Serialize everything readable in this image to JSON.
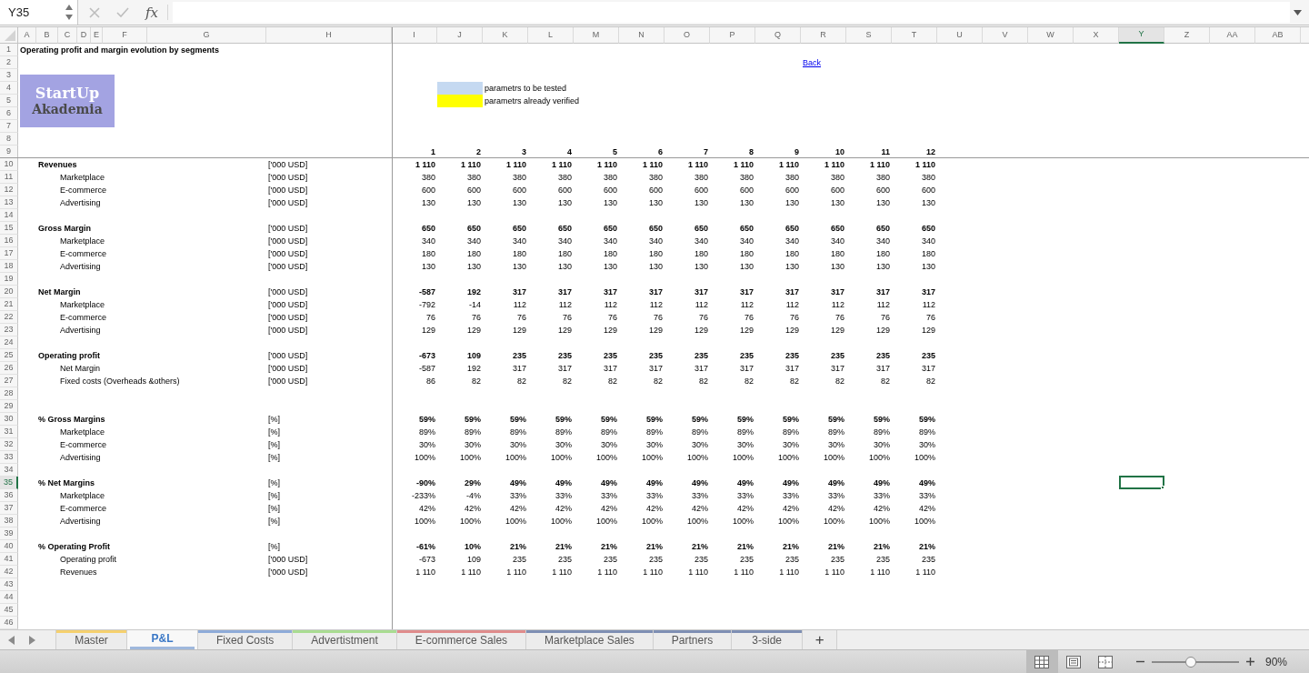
{
  "formula_bar": {
    "name_box": "Y35",
    "function_label": "fx"
  },
  "columns": [
    {
      "label": "A",
      "selected": false
    },
    {
      "label": "B",
      "selected": false
    },
    {
      "label": "C",
      "selected": false
    },
    {
      "label": "D",
      "selected": false
    },
    {
      "label": "E",
      "selected": false
    },
    {
      "label": "F",
      "selected": false
    },
    {
      "label": "G",
      "selected": false
    },
    {
      "label": "H",
      "selected": false
    },
    {
      "label": "I",
      "selected": false
    },
    {
      "label": "J",
      "selected": false
    },
    {
      "label": "K",
      "selected": false
    },
    {
      "label": "L",
      "selected": false
    },
    {
      "label": "M",
      "selected": false
    },
    {
      "label": "N",
      "selected": false
    },
    {
      "label": "O",
      "selected": false
    },
    {
      "label": "P",
      "selected": false
    },
    {
      "label": "Q",
      "selected": false
    },
    {
      "label": "R",
      "selected": false
    },
    {
      "label": "S",
      "selected": false
    },
    {
      "label": "T",
      "selected": false
    },
    {
      "label": "U",
      "selected": false
    },
    {
      "label": "V",
      "selected": false
    },
    {
      "label": "W",
      "selected": false
    },
    {
      "label": "X",
      "selected": false
    },
    {
      "label": "Y",
      "selected": true
    },
    {
      "label": "Z",
      "selected": false
    },
    {
      "label": "AA",
      "selected": false
    },
    {
      "label": "AB",
      "selected": false
    }
  ],
  "rows": [
    {
      "label": "1",
      "selected": false
    },
    {
      "label": "2",
      "selected": false
    },
    {
      "label": "3",
      "selected": false
    },
    {
      "label": "4",
      "selected": false
    },
    {
      "label": "5",
      "selected": false
    },
    {
      "label": "6",
      "selected": false
    },
    {
      "label": "7",
      "selected": false
    },
    {
      "label": "8",
      "selected": false
    },
    {
      "label": "9",
      "selected": false
    },
    {
      "label": "10",
      "selected": false
    },
    {
      "label": "11",
      "selected": false
    },
    {
      "label": "12",
      "selected": false
    },
    {
      "label": "13",
      "selected": false
    },
    {
      "label": "14",
      "selected": false
    },
    {
      "label": "15",
      "selected": false
    },
    {
      "label": "16",
      "selected": false
    },
    {
      "label": "17",
      "selected": false
    },
    {
      "label": "18",
      "selected": false
    },
    {
      "label": "19",
      "selected": false
    },
    {
      "label": "20",
      "selected": false
    },
    {
      "label": "21",
      "selected": false
    },
    {
      "label": "22",
      "selected": false
    },
    {
      "label": "23",
      "selected": false
    },
    {
      "label": "24",
      "selected": false
    },
    {
      "label": "25",
      "selected": false
    },
    {
      "label": "26",
      "selected": false
    },
    {
      "label": "27",
      "selected": false
    },
    {
      "label": "28",
      "selected": false
    },
    {
      "label": "29",
      "selected": false
    },
    {
      "label": "30",
      "selected": false
    },
    {
      "label": "31",
      "selected": false
    },
    {
      "label": "32",
      "selected": false
    },
    {
      "label": "33",
      "selected": false
    },
    {
      "label": "34",
      "selected": false
    },
    {
      "label": "35",
      "selected": true
    },
    {
      "label": "36",
      "selected": false
    },
    {
      "label": "37",
      "selected": false
    },
    {
      "label": "38",
      "selected": false
    },
    {
      "label": "39",
      "selected": false
    },
    {
      "label": "40",
      "selected": false
    },
    {
      "label": "41",
      "selected": false
    },
    {
      "label": "42",
      "selected": false
    },
    {
      "label": "43",
      "selected": false
    },
    {
      "label": "44",
      "selected": false
    },
    {
      "label": "45",
      "selected": false
    },
    {
      "label": "46",
      "selected": false
    }
  ],
  "sheet": {
    "title": "Operating profit and margin evolution by segments",
    "logo": {
      "top_word": "StartUp",
      "bottom_word": "Akademia"
    },
    "back_link": "Back",
    "legend": [
      {
        "label": "parametrs to be tested",
        "color": "#c5d9f1"
      },
      {
        "label": "parametrs already verified",
        "color": "#ffff00"
      }
    ],
    "periods": [
      "1",
      "2",
      "3",
      "4",
      "5",
      "6",
      "7",
      "8",
      "9",
      "10",
      "11",
      "12"
    ],
    "sections": [
      {
        "blocks": [
          {
            "label": "Revenues",
            "unit": "['000 USD]",
            "values": [
              "1 110",
              "1 110",
              "1 110",
              "1 110",
              "1 110",
              "1 110",
              "1 110",
              "1 110",
              "1 110",
              "1 110",
              "1 110",
              "1 110"
            ],
            "items": [
              {
                "label": "Marketplace",
                "unit": "['000 USD]",
                "values": [
                  "380",
                  "380",
                  "380",
                  "380",
                  "380",
                  "380",
                  "380",
                  "380",
                  "380",
                  "380",
                  "380",
                  "380"
                ]
              },
              {
                "label": "E-commerce",
                "unit": "['000 USD]",
                "values": [
                  "600",
                  "600",
                  "600",
                  "600",
                  "600",
                  "600",
                  "600",
                  "600",
                  "600",
                  "600",
                  "600",
                  "600"
                ]
              },
              {
                "label": "Advertising",
                "unit": "['000 USD]",
                "values": [
                  "130",
                  "130",
                  "130",
                  "130",
                  "130",
                  "130",
                  "130",
                  "130",
                  "130",
                  "130",
                  "130",
                  "130"
                ]
              }
            ]
          },
          {
            "label": "Gross Margin",
            "unit": "['000 USD]",
            "values": [
              "650",
              "650",
              "650",
              "650",
              "650",
              "650",
              "650",
              "650",
              "650",
              "650",
              "650",
              "650"
            ],
            "items": [
              {
                "label": "Marketplace",
                "unit": "['000 USD]",
                "values": [
                  "340",
                  "340",
                  "340",
                  "340",
                  "340",
                  "340",
                  "340",
                  "340",
                  "340",
                  "340",
                  "340",
                  "340"
                ]
              },
              {
                "label": "E-commerce",
                "unit": "['000 USD]",
                "values": [
                  "180",
                  "180",
                  "180",
                  "180",
                  "180",
                  "180",
                  "180",
                  "180",
                  "180",
                  "180",
                  "180",
                  "180"
                ]
              },
              {
                "label": "Advertising",
                "unit": "['000 USD]",
                "values": [
                  "130",
                  "130",
                  "130",
                  "130",
                  "130",
                  "130",
                  "130",
                  "130",
                  "130",
                  "130",
                  "130",
                  "130"
                ]
              }
            ]
          },
          {
            "label": "Net Margin",
            "unit": "['000 USD]",
            "values": [
              "-587",
              "192",
              "317",
              "317",
              "317",
              "317",
              "317",
              "317",
              "317",
              "317",
              "317",
              "317"
            ],
            "items": [
              {
                "label": "Marketplace",
                "unit": "['000 USD]",
                "values": [
                  "-792",
                  "-14",
                  "112",
                  "112",
                  "112",
                  "112",
                  "112",
                  "112",
                  "112",
                  "112",
                  "112",
                  "112"
                ]
              },
              {
                "label": "E-commerce",
                "unit": "['000 USD]",
                "values": [
                  "76",
                  "76",
                  "76",
                  "76",
                  "76",
                  "76",
                  "76",
                  "76",
                  "76",
                  "76",
                  "76",
                  "76"
                ]
              },
              {
                "label": "Advertising",
                "unit": "['000 USD]",
                "values": [
                  "129",
                  "129",
                  "129",
                  "129",
                  "129",
                  "129",
                  "129",
                  "129",
                  "129",
                  "129",
                  "129",
                  "129"
                ]
              }
            ]
          },
          {
            "label": "Operating profit",
            "unit": "['000 USD]",
            "values": [
              "-673",
              "109",
              "235",
              "235",
              "235",
              "235",
              "235",
              "235",
              "235",
              "235",
              "235",
              "235"
            ],
            "items": [
              {
                "label": "Net Margin",
                "unit": "['000 USD]",
                "values": [
                  "-587",
                  "192",
                  "317",
                  "317",
                  "317",
                  "317",
                  "317",
                  "317",
                  "317",
                  "317",
                  "317",
                  "317"
                ]
              },
              {
                "label": "Fixed costs (Overheads &others)",
                "unit": "['000 USD]",
                "values": [
                  "86",
                  "82",
                  "82",
                  "82",
                  "82",
                  "82",
                  "82",
                  "82",
                  "82",
                  "82",
                  "82",
                  "82"
                ]
              }
            ]
          }
        ]
      },
      {
        "blocks": [
          {
            "label": "% Gross Margins",
            "unit": "[%]",
            "values": [
              "59%",
              "59%",
              "59%",
              "59%",
              "59%",
              "59%",
              "59%",
              "59%",
              "59%",
              "59%",
              "59%",
              "59%"
            ],
            "items": [
              {
                "label": "Marketplace",
                "unit": "[%]",
                "values": [
                  "89%",
                  "89%",
                  "89%",
                  "89%",
                  "89%",
                  "89%",
                  "89%",
                  "89%",
                  "89%",
                  "89%",
                  "89%",
                  "89%"
                ]
              },
              {
                "label": "E-commerce",
                "unit": "[%]",
                "values": [
                  "30%",
                  "30%",
                  "30%",
                  "30%",
                  "30%",
                  "30%",
                  "30%",
                  "30%",
                  "30%",
                  "30%",
                  "30%",
                  "30%"
                ]
              },
              {
                "label": "Advertising",
                "unit": "[%]",
                "values": [
                  "100%",
                  "100%",
                  "100%",
                  "100%",
                  "100%",
                  "100%",
                  "100%",
                  "100%",
                  "100%",
                  "100%",
                  "100%",
                  "100%"
                ]
              }
            ]
          },
          {
            "label": "% Net Margins",
            "unit": "[%]",
            "values": [
              "-90%",
              "29%",
              "49%",
              "49%",
              "49%",
              "49%",
              "49%",
              "49%",
              "49%",
              "49%",
              "49%",
              "49%"
            ],
            "items": [
              {
                "label": "Marketplace",
                "unit": "[%]",
                "values": [
                  "-233%",
                  "-4%",
                  "33%",
                  "33%",
                  "33%",
                  "33%",
                  "33%",
                  "33%",
                  "33%",
                  "33%",
                  "33%",
                  "33%"
                ]
              },
              {
                "label": "E-commerce",
                "unit": "[%]",
                "values": [
                  "42%",
                  "42%",
                  "42%",
                  "42%",
                  "42%",
                  "42%",
                  "42%",
                  "42%",
                  "42%",
                  "42%",
                  "42%",
                  "42%"
                ]
              },
              {
                "label": "Advertising",
                "unit": "[%]",
                "values": [
                  "100%",
                  "100%",
                  "100%",
                  "100%",
                  "100%",
                  "100%",
                  "100%",
                  "100%",
                  "100%",
                  "100%",
                  "100%",
                  "100%"
                ]
              }
            ]
          },
          {
            "label": "% Operating Profit",
            "unit": "[%]",
            "values": [
              "-61%",
              "10%",
              "21%",
              "21%",
              "21%",
              "21%",
              "21%",
              "21%",
              "21%",
              "21%",
              "21%",
              "21%"
            ],
            "items": [
              {
                "label": "Operating profit",
                "unit": "['000 USD]",
                "values": [
                  "-673",
                  "109",
                  "235",
                  "235",
                  "235",
                  "235",
                  "235",
                  "235",
                  "235",
                  "235",
                  "235",
                  "235"
                ]
              },
              {
                "label": "Revenues",
                "unit": "['000 USD]",
                "values": [
                  "1 110",
                  "1 110",
                  "1 110",
                  "1 110",
                  "1 110",
                  "1 110",
                  "1 110",
                  "1 110",
                  "1 110",
                  "1 110",
                  "1 110",
                  "1 110"
                ]
              }
            ]
          }
        ]
      }
    ]
  },
  "tabs": [
    {
      "label": "Master",
      "selected": false,
      "color": "#f5d06e"
    },
    {
      "label": "P&L",
      "selected": true,
      "color": "#9fb8dd"
    },
    {
      "label": "Fixed Costs",
      "selected": false,
      "color": "#8eabd9"
    },
    {
      "label": "Advertistment",
      "selected": false,
      "color": "#a9dc92"
    },
    {
      "label": "E-commerce Sales",
      "selected": false,
      "color": "#df8c8c"
    },
    {
      "label": "Marketplace Sales",
      "selected": false,
      "color": "#7e8fb4"
    },
    {
      "label": "Partners",
      "selected": false,
      "color": "#7e8fb4"
    },
    {
      "label": "3-side",
      "selected": false,
      "color": "#7e8fb4"
    }
  ],
  "add_tab": "+",
  "status_bar": {
    "views": [
      {
        "kind": "normal",
        "selected": true
      },
      {
        "kind": "page_layout",
        "selected": false
      },
      {
        "kind": "page_break",
        "selected": false
      }
    ],
    "zoom": {
      "level": 0.45,
      "reading": "90%"
    }
  }
}
